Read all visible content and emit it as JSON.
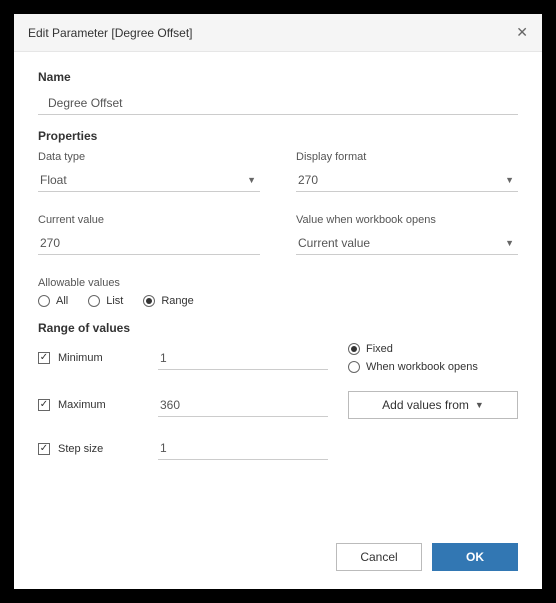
{
  "dialog": {
    "title": "Edit Parameter [Degree Offset]"
  },
  "name": {
    "label": "Name",
    "value": "Degree Offset"
  },
  "properties": {
    "heading": "Properties",
    "data_type": {
      "label": "Data type",
      "value": "Float"
    },
    "display_format": {
      "label": "Display format",
      "value": "270"
    },
    "current_value": {
      "label": "Current value",
      "value": "270"
    },
    "value_when_open": {
      "label": "Value when workbook opens",
      "value": "Current value"
    }
  },
  "allowable": {
    "label": "Allowable values",
    "options": {
      "all": "All",
      "list": "List",
      "range": "Range"
    },
    "selected": "range"
  },
  "range": {
    "heading": "Range of values",
    "minimum": {
      "label": "Minimum",
      "value": "1",
      "checked": true
    },
    "maximum": {
      "label": "Maximum",
      "value": "360",
      "checked": true
    },
    "step": {
      "label": "Step size",
      "value": "1",
      "checked": true
    },
    "mode": {
      "fixed": "Fixed",
      "when_open": "When workbook opens",
      "selected": "fixed"
    },
    "add_from": "Add values from"
  },
  "footer": {
    "cancel": "Cancel",
    "ok": "OK"
  }
}
